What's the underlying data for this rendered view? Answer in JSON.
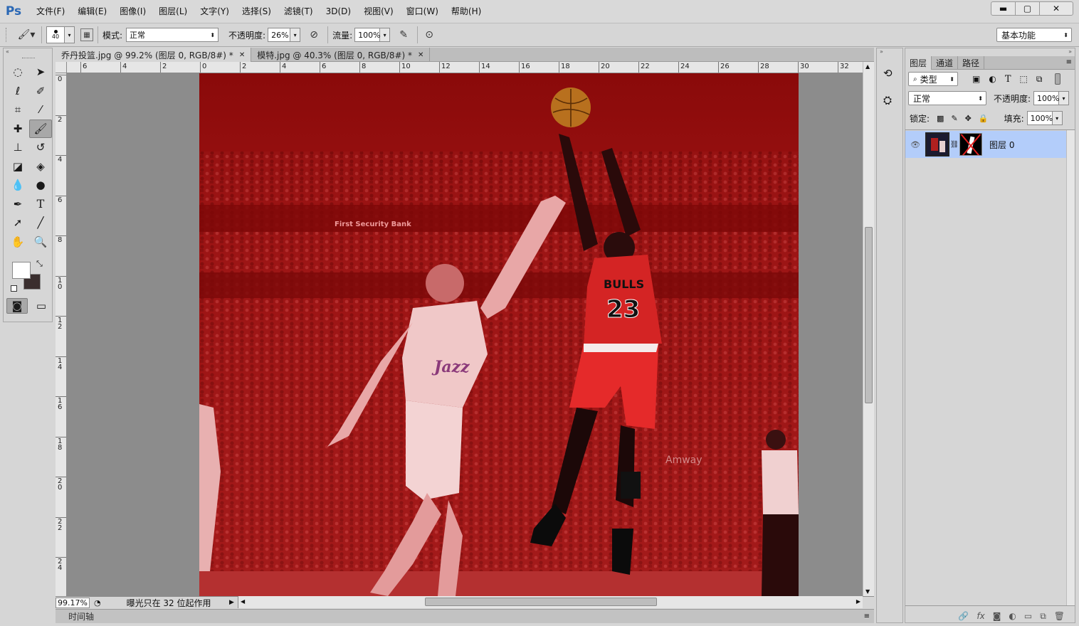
{
  "app": {
    "logo": "Ps"
  },
  "menu": [
    "文件(F)",
    "编辑(E)",
    "图像(I)",
    "图层(L)",
    "文字(Y)",
    "选择(S)",
    "滤镜(T)",
    "3D(D)",
    "视图(V)",
    "窗口(W)",
    "帮助(H)"
  ],
  "options": {
    "brush_size": "40",
    "mode_label": "模式:",
    "mode_value": "正常",
    "opacity_label": "不透明度:",
    "opacity_value": "26%",
    "flow_label": "流量:",
    "flow_value": "100%",
    "workspace": "基本功能"
  },
  "tabs": [
    {
      "label": "乔丹投篮.jpg @ 99.2% (图层 0, RGB/8#) *"
    },
    {
      "label": "模特.jpg @ 40.3% (图层 0, RGB/8#) *"
    }
  ],
  "rulers": {
    "top": [
      "6",
      "4",
      "2",
      "0",
      "2",
      "4",
      "6",
      "8",
      "10",
      "12",
      "14",
      "16",
      "18",
      "20",
      "22",
      "24",
      "26",
      "28",
      "30",
      "32"
    ],
    "left": [
      "0",
      "2",
      "4",
      "6",
      "8",
      "10",
      "12",
      "14",
      "16",
      "18",
      "20",
      "22",
      "24"
    ]
  },
  "canvas": {
    "overlay_color": "#a11212",
    "jersey_number": "23",
    "jersey_team": "BULLS",
    "opponent_team": "Jazz",
    "banner_text": "First Security Bank",
    "sponsor_text": "Amway"
  },
  "status": {
    "zoom": "99.17%",
    "message": "曝光只在 32 位起作用",
    "timeline": "时间轴"
  },
  "panel": {
    "tabs": [
      "图层",
      "通道",
      "路径"
    ],
    "filter_kind": "类型",
    "blend_mode": "正常",
    "opacity_label": "不透明度:",
    "opacity_value": "100%",
    "lock_label": "锁定:",
    "fill_label": "填充:",
    "fill_value": "100%",
    "layer_name": "图层 0"
  }
}
